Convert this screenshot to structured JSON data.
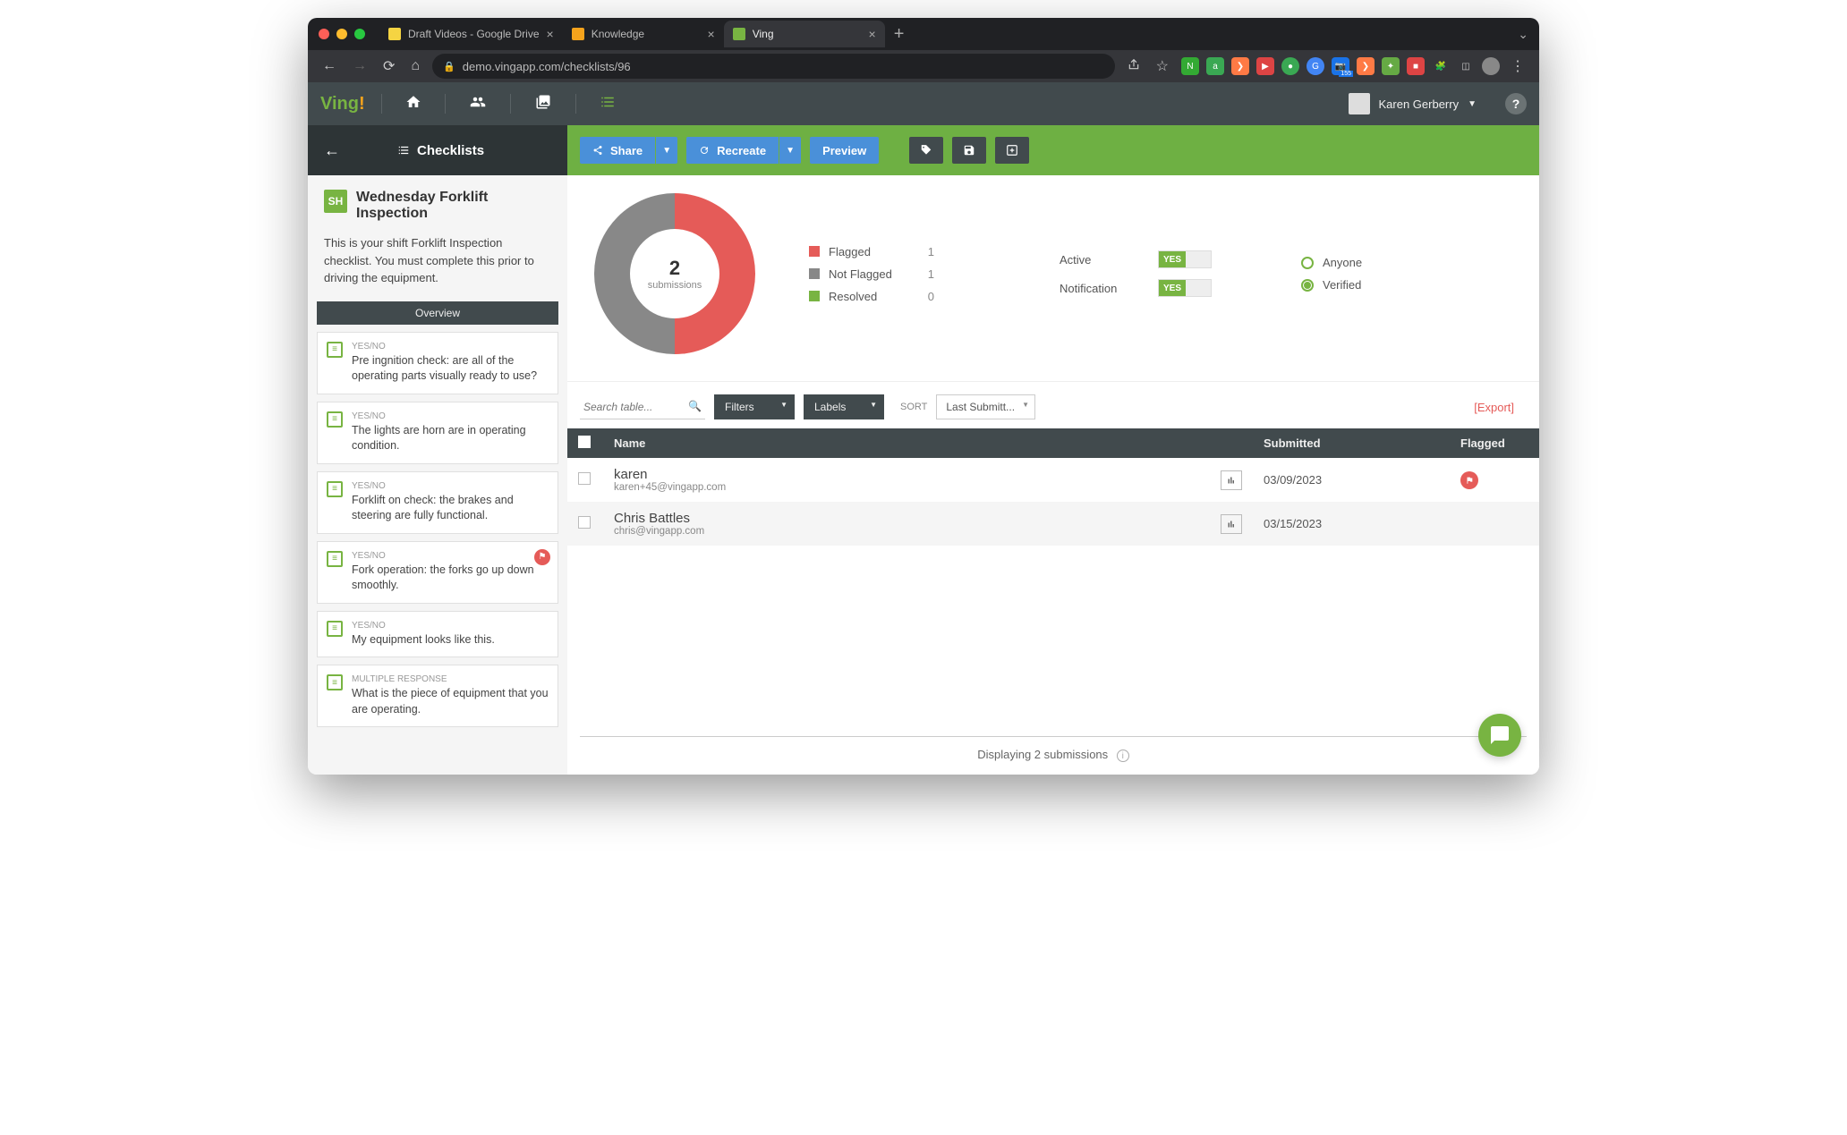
{
  "browser": {
    "tabs": [
      {
        "title": "Draft Videos - Google Drive"
      },
      {
        "title": "Knowledge"
      },
      {
        "title": "Ving"
      }
    ],
    "url": "demo.vingapp.com/checklists/96"
  },
  "app_header": {
    "user_name": "Karen Gerberry"
  },
  "sidebar": {
    "section_label": "Checklists",
    "badge": "SH",
    "title": "Wednesday Forklift Inspection",
    "description": "This is your shift Forklift Inspection checklist. You must complete this prior to driving the equipment.",
    "overview_label": "Overview",
    "questions": [
      {
        "type": "YES/NO",
        "text": "Pre ingnition check: are all of the operating parts visually ready to use?",
        "flagged": false
      },
      {
        "type": "YES/NO",
        "text": "The lights are horn are in operating condition.",
        "flagged": false
      },
      {
        "type": "YES/NO",
        "text": "Forklift on check: the brakes and steering are fully functional.",
        "flagged": false
      },
      {
        "type": "YES/NO",
        "text": "Fork operation: the forks go up down smoothly.",
        "flagged": true
      },
      {
        "type": "YES/NO",
        "text": "My equipment looks like this.",
        "flagged": false
      },
      {
        "type": "MULTIPLE RESPONSE",
        "text": "What is the piece of equipment that you are operating.",
        "flagged": false
      }
    ]
  },
  "actions": {
    "share": "Share",
    "recreate": "Recreate",
    "preview": "Preview"
  },
  "chart_data": {
    "type": "pie",
    "title": "",
    "center_value": 2,
    "center_label": "submissions",
    "series": [
      {
        "name": "Flagged",
        "value": 1,
        "color": "#e55b58"
      },
      {
        "name": "Not Flagged",
        "value": 1,
        "color": "#888888"
      },
      {
        "name": "Resolved",
        "value": 0,
        "color": "#78b442"
      }
    ]
  },
  "toggles": {
    "active_label": "Active",
    "active_value": "YES",
    "notification_label": "Notification",
    "notification_value": "YES"
  },
  "filter_radio": {
    "anyone": "Anyone",
    "verified": "Verified",
    "selected": "verified"
  },
  "table_controls": {
    "search_placeholder": "Search table...",
    "filters": "Filters",
    "labels": "Labels",
    "sort_label": "SORT",
    "sort_value": "Last Submitt...",
    "export": "[Export]"
  },
  "table": {
    "headers": {
      "name": "Name",
      "submitted": "Submitted",
      "flagged": "Flagged"
    },
    "rows": [
      {
        "name": "karen",
        "email": "karen+45@vingapp.com",
        "submitted": "03/09/2023",
        "flagged": true
      },
      {
        "name": "Chris Battles",
        "email": "chris@vingapp.com",
        "submitted": "03/15/2023",
        "flagged": false
      }
    ],
    "footer": "Displaying 2 submissions"
  }
}
